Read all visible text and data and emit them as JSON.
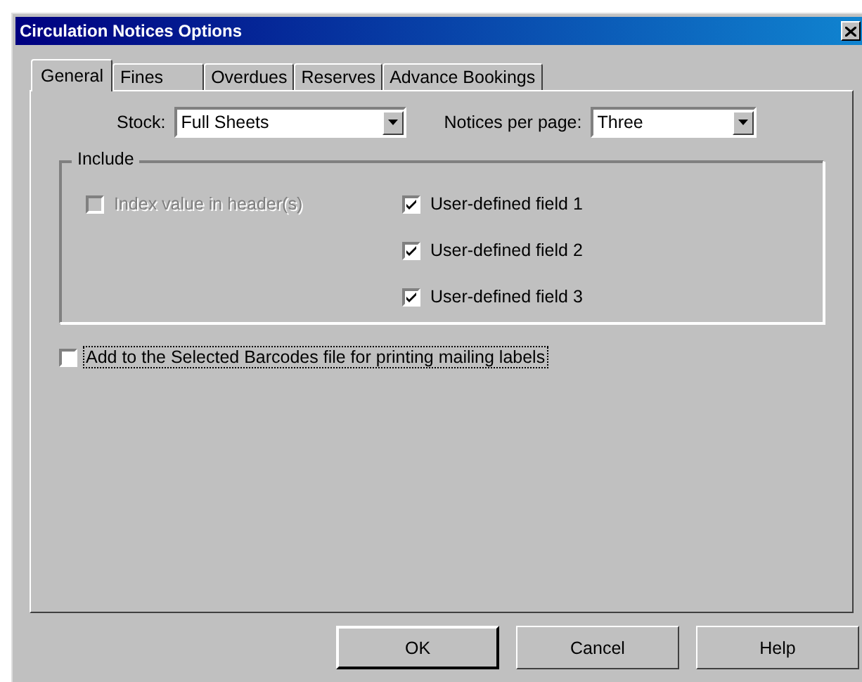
{
  "window": {
    "title": "Circulation Notices Options"
  },
  "tabs": [
    {
      "label": "General",
      "selected": true
    },
    {
      "label": "Fines",
      "selected": false
    },
    {
      "label": "Overdues",
      "selected": false
    },
    {
      "label": "Reserves",
      "selected": false
    },
    {
      "label": "Advance Bookings",
      "selected": false
    }
  ],
  "stock": {
    "label": "Stock:",
    "value": "Full Sheets"
  },
  "notices_per_page": {
    "label": "Notices per page:",
    "value": "Three"
  },
  "include": {
    "title": "Include",
    "options": [
      {
        "label": "Index value in header(s)",
        "checked": false,
        "disabled": true
      },
      {
        "label": "User-defined field 1",
        "checked": true,
        "disabled": false
      },
      {
        "label": "User-defined field 2",
        "checked": true,
        "disabled": false
      },
      {
        "label": "User-defined field 3",
        "checked": true,
        "disabled": false
      }
    ]
  },
  "barcodes_option": {
    "label": "Add to the Selected Barcodes file for printing mailing labels",
    "checked": false,
    "focused": true
  },
  "buttons": [
    {
      "label": "OK",
      "default": true
    },
    {
      "label": "Cancel",
      "default": false
    },
    {
      "label": "Help",
      "default": false
    }
  ]
}
